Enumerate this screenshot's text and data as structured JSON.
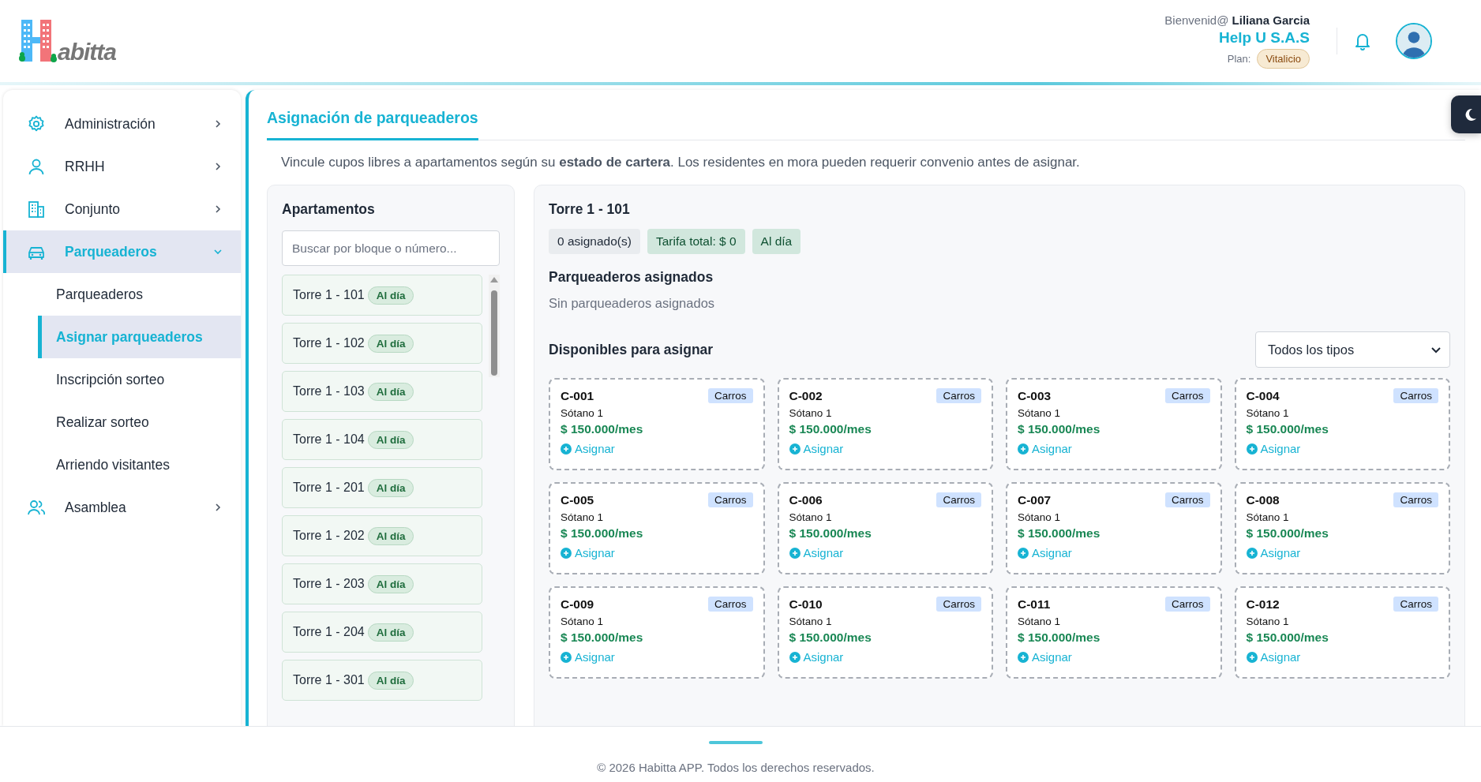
{
  "header": {
    "logo_text": "abitta",
    "greeting": "Bienvenid@",
    "user_name": "Liliana Garcia",
    "company": "Help U S.A.S",
    "plan_label": "Plan:",
    "plan": "Vitalicio"
  },
  "sidebar": {
    "items": [
      {
        "label": "Administración",
        "expanded": false,
        "selected": false
      },
      {
        "label": "RRHH",
        "expanded": false,
        "selected": false
      },
      {
        "label": "Conjunto",
        "expanded": false,
        "selected": false
      },
      {
        "label": "Parqueaderos",
        "expanded": true,
        "selected": true,
        "children": [
          {
            "label": "Parqueaderos",
            "selected": false
          },
          {
            "label": "Asignar parqueaderos",
            "selected": true
          },
          {
            "label": "Inscripción sorteo",
            "selected": false
          },
          {
            "label": "Realizar sorteo",
            "selected": false
          },
          {
            "label": "Arriendo visitantes",
            "selected": false
          }
        ]
      },
      {
        "label": "Asamblea",
        "expanded": false,
        "selected": false
      }
    ]
  },
  "main": {
    "title": "Asignación de parqueaderos",
    "description": "Vincule cupos libres a apartamentos según su **estado de cartera**. Los residentes en mora pueden requerir convenio antes de asignar.",
    "apartments": {
      "heading": "Apartamentos",
      "search": {
        "placeholder": "Buscar por bloque o número..."
      },
      "items": [
        {
          "label": "Torre 1 - 101",
          "status": "Al día"
        },
        {
          "label": "Torre 1 - 102",
          "status": "Al día"
        },
        {
          "label": "Torre 1 - 103",
          "status": "Al día"
        },
        {
          "label": "Torre 1 - 104",
          "status": "Al día"
        },
        {
          "label": "Torre 1 - 201",
          "status": "Al día"
        },
        {
          "label": "Torre 1 - 202",
          "status": "Al día"
        },
        {
          "label": "Torre 1 - 203",
          "status": "Al día"
        },
        {
          "label": "Torre 1 - 204",
          "status": "Al día"
        },
        {
          "label": "Torre 1 - 301",
          "status": "Al día"
        }
      ]
    },
    "detail": {
      "title": "Torre 1 - 101",
      "chips": [
        {
          "text": "0 asignado(s)",
          "kind": "neutral"
        },
        {
          "text": "Tarifa total: $ 0",
          "kind": "success"
        },
        {
          "text": "Al día",
          "kind": "success"
        }
      ],
      "assigned_heading": "Parqueaderos asignados",
      "assigned_empty": "Sin parqueaderos asignados",
      "available_heading": "Disponibles para asignar",
      "type_filter": "Todos los tipos",
      "spots": [
        {
          "code": "C-001",
          "type": "Carros",
          "location": "Sótano 1",
          "price": "$ 150.000/mes",
          "action": "Asignar"
        },
        {
          "code": "C-002",
          "type": "Carros",
          "location": "Sótano 1",
          "price": "$ 150.000/mes",
          "action": "Asignar"
        },
        {
          "code": "C-003",
          "type": "Carros",
          "location": "Sótano 1",
          "price": "$ 150.000/mes",
          "action": "Asignar"
        },
        {
          "code": "C-004",
          "type": "Carros",
          "location": "Sótano 1",
          "price": "$ 150.000/mes",
          "action": "Asignar"
        },
        {
          "code": "C-005",
          "type": "Carros",
          "location": "Sótano 1",
          "price": "$ 150.000/mes",
          "action": "Asignar"
        },
        {
          "code": "C-006",
          "type": "Carros",
          "location": "Sótano 1",
          "price": "$ 150.000/mes",
          "action": "Asignar"
        },
        {
          "code": "C-007",
          "type": "Carros",
          "location": "Sótano 1",
          "price": "$ 150.000/mes",
          "action": "Asignar"
        },
        {
          "code": "C-008",
          "type": "Carros",
          "location": "Sótano 1",
          "price": "$ 150.000/mes",
          "action": "Asignar"
        },
        {
          "code": "C-009",
          "type": "Carros",
          "location": "Sótano 1",
          "price": "$ 150.000/mes",
          "action": "Asignar"
        },
        {
          "code": "C-010",
          "type": "Carros",
          "location": "Sótano 1",
          "price": "$ 150.000/mes",
          "action": "Asignar"
        },
        {
          "code": "C-011",
          "type": "Carros",
          "location": "Sótano 1",
          "price": "$ 150.000/mes",
          "action": "Asignar"
        },
        {
          "code": "C-012",
          "type": "Carros",
          "location": "Sótano 1",
          "price": "$ 150.000/mes",
          "action": "Asignar"
        }
      ]
    }
  },
  "footer": {
    "text": "© 2026 Habitta APP. Todos los derechos reservados."
  }
}
